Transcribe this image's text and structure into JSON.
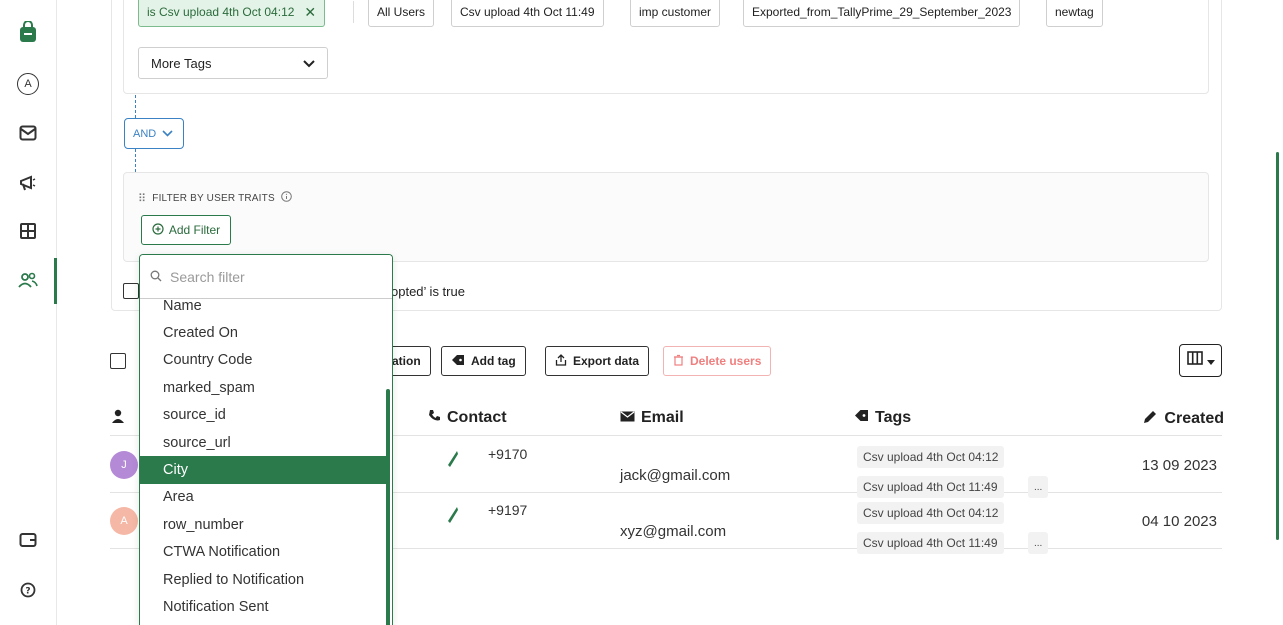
{
  "sidebar": {
    "items": [
      {
        "name": "shopping-bag-icon"
      },
      {
        "name": "avatar-a",
        "label": "A"
      },
      {
        "name": "inbox-icon"
      },
      {
        "name": "megaphone-icon"
      },
      {
        "name": "grid-icon"
      },
      {
        "name": "users-icon"
      },
      {
        "name": "wallet-icon"
      },
      {
        "name": "help-icon"
      }
    ],
    "accent": "#2a7a4b"
  },
  "tag_filter": {
    "selected_tag": "is Csv upload 4th Oct 04:12",
    "tags": [
      "All Users",
      "Csv upload 4th Oct 11:49",
      "imp customer",
      "Exported_from_TallyPrime_29_September_2023",
      "newtag"
    ],
    "more_tags": "More Tags"
  },
  "operator": "AND",
  "traits": {
    "title": "FILTER BY USER TRAITS",
    "add_filter": "Add Filter"
  },
  "opted_text": "opted’ is true",
  "dropdown": {
    "search_placeholder": "Search filter",
    "items": [
      "Name",
      "Created On",
      "Country Code",
      "marked_spam",
      "source_id",
      "source_url",
      "City",
      "Area",
      "row_number",
      "CTWA Notification",
      "Replied to Notification",
      "Notification Sent"
    ],
    "active_item": "City"
  },
  "toolbar": {
    "partial_label": "ation",
    "add_tag": "Add tag",
    "export": "Export data",
    "delete": "Delete users"
  },
  "table": {
    "headers": {
      "contact": "Contact",
      "email": "Email",
      "tags": "Tags",
      "created": "Created"
    },
    "rows": [
      {
        "avatar": "J",
        "avatar_color": "#b48ad6",
        "contact": "+9170",
        "email": "jack@gmail.com",
        "tags": [
          "Csv upload 4th Oct 04:12",
          "Csv upload 4th Oct 11:49"
        ],
        "more": "...",
        "created": "13 09 2023"
      },
      {
        "avatar": "A",
        "avatar_color": "#f5b8a6",
        "contact": "+9197",
        "email": "xyz@gmail.com",
        "tags": [
          "Csv upload 4th Oct 04:12",
          "Csv upload 4th Oct 11:49"
        ],
        "more": "...",
        "created": "04 10 2023"
      }
    ]
  }
}
